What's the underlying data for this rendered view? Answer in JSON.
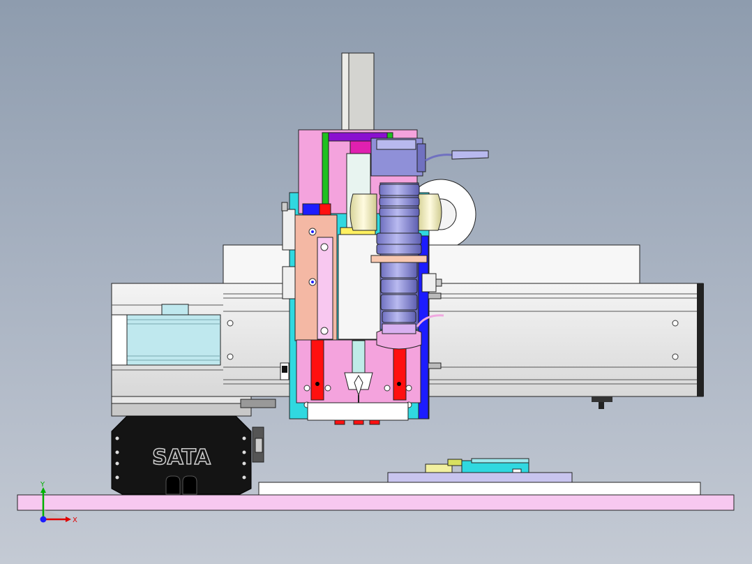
{
  "brand": {
    "text": "SATA"
  },
  "triad": {
    "x_label": "X",
    "y_label": "Y"
  },
  "colors": {
    "background_top": "#8e9cae",
    "background_bottom": "#c4cad4",
    "base_plate": "#f7c8f0",
    "carriage_pink": "#f4a3dd",
    "salmon_plate": "#f4b8a4",
    "motor_body": "#bfe8ee",
    "servo_black": "#141414",
    "lens_blue": "#8f90d8",
    "rail_red": "#ff1010",
    "accent_green": "#20c020",
    "accent_cyan": "#30d8e0",
    "accent_blue": "#1c1cff",
    "accent_yellow": "#fff060"
  }
}
